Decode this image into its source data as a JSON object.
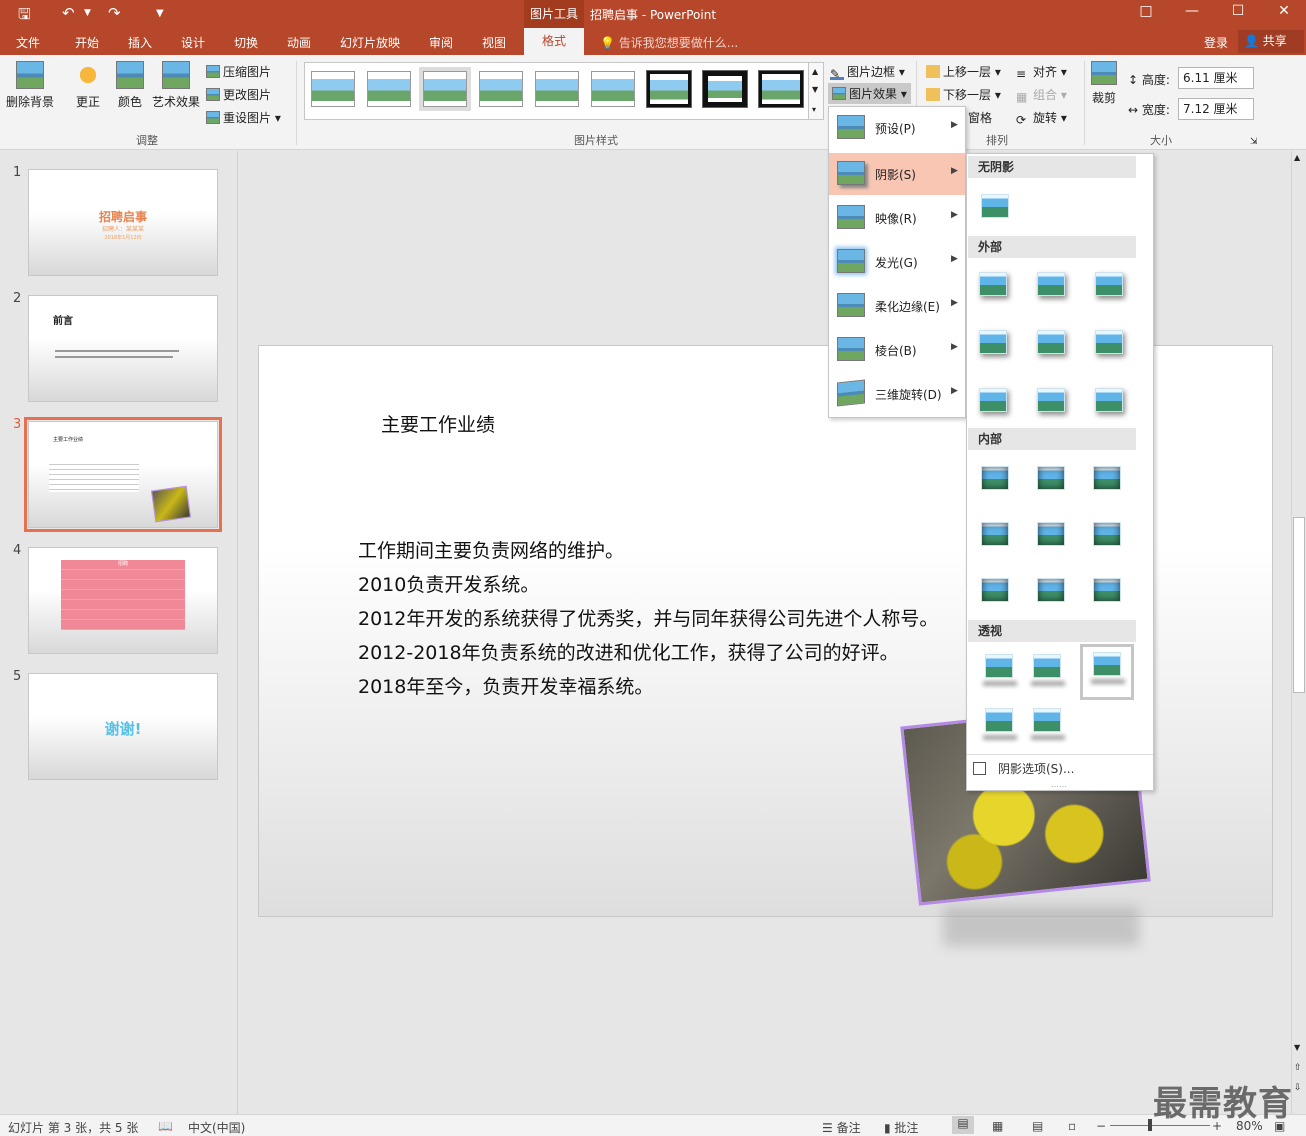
{
  "titlebar": {
    "context_tab": "图片工具",
    "doc_title": "招聘启事 - PowerPoint"
  },
  "tabs": [
    "文件",
    "开始",
    "插入",
    "设计",
    "切换",
    "动画",
    "幻灯片放映",
    "审阅",
    "视图"
  ],
  "active_tab": "格式",
  "tell_me_placeholder": "告诉我您想要做什么...",
  "account": {
    "login": "登录",
    "share": "共享"
  },
  "ribbon": {
    "adjust": {
      "remove_bg": "删除背景",
      "corrections": "更正",
      "color": "颜色",
      "artistic": "艺术效果",
      "compress": "压缩图片",
      "change": "更改图片",
      "reset": "重设图片",
      "label": "调整"
    },
    "styles": {
      "label": "图片样式",
      "border": "图片边框",
      "effects": "图片效果"
    },
    "arrange": {
      "bring_forward": "上移一层",
      "send_backward": "下移一层",
      "pane": "窗格",
      "align": "对齐",
      "group": "组合",
      "rotate": "旋转",
      "label": "排列"
    },
    "size": {
      "crop": "裁剪",
      "height_label": "高度:",
      "height_value": "6.11 厘米",
      "width_label": "宽度:",
      "width_value": "7.12 厘米",
      "label": "大小"
    }
  },
  "effects_menu": [
    {
      "label": "预设(P)"
    },
    {
      "label": "阴影(S)"
    },
    {
      "label": "映像(R)"
    },
    {
      "label": "发光(G)"
    },
    {
      "label": "柔化边缘(E)"
    },
    {
      "label": "棱台(B)"
    },
    {
      "label": "三维旋转(D)"
    }
  ],
  "shadow_panel": {
    "none": "无阴影",
    "outer": "外部",
    "inner": "内部",
    "perspective": "透视",
    "options": "阴影选项(S)..."
  },
  "slides": [
    {
      "num": "1",
      "title": "招聘启事",
      "subtitle": "招聘人：某某某",
      "date": "2018年1月12日"
    },
    {
      "num": "2",
      "title": "前言"
    },
    {
      "num": "3",
      "title": "主要工作业绩"
    },
    {
      "num": "4",
      "title": "招聘"
    },
    {
      "num": "5",
      "title": "谢谢!"
    }
  ],
  "slide": {
    "title": "主要工作业绩",
    "lines": [
      "工作期间主要负责网络的维护。",
      "2010负责开发系统。",
      "2012年开发的系统获得了优秀奖，并与同年获得公司先进个人称号。",
      "2012-2018年负责系统的改进和优化工作，获得了公司的好评。",
      "2018年至今，负责开发幸福系统。"
    ]
  },
  "status": {
    "slide_info": "幻灯片 第 3 张，共 5 张",
    "language": "中文(中国)",
    "notes": "备注",
    "comments": "批注",
    "zoom": "80%"
  },
  "watermark": "最需教育"
}
